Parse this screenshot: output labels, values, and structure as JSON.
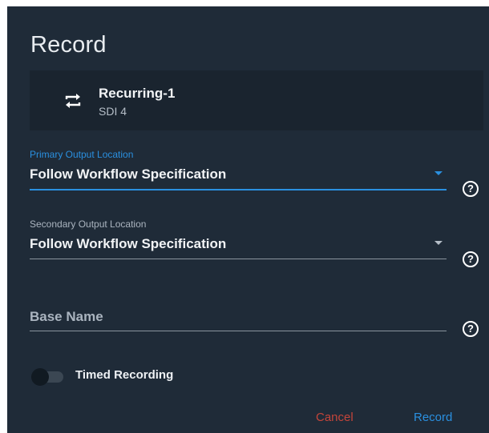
{
  "dialog": {
    "title": "Record",
    "source": {
      "icon": "recurring-icon",
      "name": "Recurring-1",
      "sub": "SDI 4"
    },
    "primary_output": {
      "label": "Primary Output Location",
      "value": "Follow Workflow Specification",
      "focused": true
    },
    "secondary_output": {
      "label": "Secondary Output Location",
      "value": "Follow Workflow Specification"
    },
    "base_name": {
      "placeholder": "Base Name",
      "value": ""
    },
    "help_icon": "help-circle-icon",
    "help_glyph": "?",
    "timed_recording": {
      "label": "Timed Recording",
      "enabled": false
    },
    "buttons": {
      "cancel": "Cancel",
      "record": "Record"
    }
  },
  "colors": {
    "dialog_bg": "#1f2b38",
    "card_bg": "#1a242f",
    "accent": "#2a90e0",
    "danger": "#c4453a"
  }
}
